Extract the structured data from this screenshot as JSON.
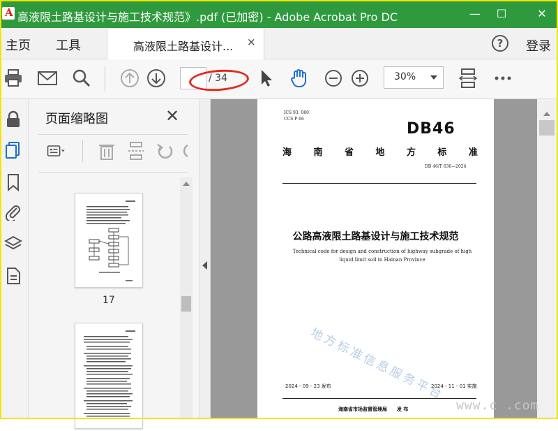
{
  "window": {
    "title": "高液限土路基设计与施工技术规范》.pdf (已加密) - Adobe Acrobat Pro DC",
    "minimize": "—",
    "maximize": "☐",
    "close": "✕"
  },
  "menu": {
    "home": "主页",
    "tools": "工具",
    "tab_title": "高液限土路基设计...",
    "tab_close": "×",
    "help": "?",
    "login": "登录"
  },
  "toolbar": {
    "page_current": "",
    "page_total": "/ 34",
    "zoom": "30%"
  },
  "thumbnail_panel": {
    "title": "页面缩略图",
    "close": "✕",
    "page_label": "17"
  },
  "document_page": {
    "ics": "ICS  93. 080",
    "ccs": "CCS  P 66",
    "logo": "DB46",
    "standard_chars": [
      "海",
      "南",
      "省",
      "地",
      "方",
      "标",
      "准"
    ],
    "number": "DB 46/T 636—2024",
    "title_cn": "公路高液限土路基设计与施工技术规范",
    "title_en": "Technical code for design and construction of highway subgrade of high liquid limit soil in Hainan Province",
    "watermark": "地方标准信息服务平台",
    "issue_date": "2024 - 09 - 23 发布",
    "impl_date": "2024 - 11 - 01 实施",
    "issuer": "海南省市场监督管理局　　发 布"
  },
  "overlay_watermark": "www.c    .com",
  "colors": {
    "titlebar": "#2f9a3d",
    "annotation": "#e22b22",
    "frame": "#f2e600",
    "hand_tool": "#1f6fd0"
  }
}
